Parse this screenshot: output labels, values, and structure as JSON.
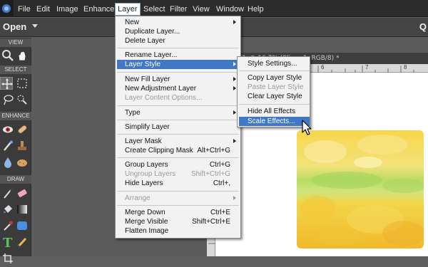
{
  "menubar": {
    "items": [
      {
        "label": "File"
      },
      {
        "label": "Edit"
      },
      {
        "label": "Image"
      },
      {
        "label": "Enhance"
      },
      {
        "label": "Layer"
      },
      {
        "label": "Select"
      },
      {
        "label": "Filter"
      },
      {
        "label": "View"
      },
      {
        "label": "Window"
      },
      {
        "label": "Help"
      }
    ],
    "active": "Layer"
  },
  "modebar": {
    "open_label": "Open",
    "right_label": "Q"
  },
  "toolbox": {
    "sections": [
      "VIEW",
      "SELECT",
      "ENHANCE",
      "DRAW"
    ]
  },
  "document": {
    "tab_title": "7, @ 16.7% (Slices 1, RGB/8) *",
    "ruler_ticks": [
      "5",
      "6",
      "7",
      "8"
    ]
  },
  "layer_menu": {
    "items": [
      {
        "label": "New",
        "submenu": true
      },
      {
        "label": "Duplicate Layer..."
      },
      {
        "label": "Delete Layer"
      },
      {
        "label": "Rename Layer..."
      },
      {
        "label": "Layer Style",
        "submenu": true,
        "highlighted": true
      },
      {
        "label": "New Fill Layer",
        "submenu": true
      },
      {
        "label": "New Adjustment Layer",
        "submenu": true
      },
      {
        "label": "Layer Content Options...",
        "disabled": true
      },
      {
        "label": "Type",
        "submenu": true
      },
      {
        "label": "Simplify Layer"
      },
      {
        "label": "Layer Mask",
        "submenu": true
      },
      {
        "label": "Create Clipping Mask",
        "shortcut": "Alt+Ctrl+G"
      },
      {
        "label": "Group Layers",
        "shortcut": "Ctrl+G"
      },
      {
        "label": "Ungroup Layers",
        "shortcut": "Shift+Ctrl+G",
        "disabled": true
      },
      {
        "label": "Hide Layers",
        "shortcut": "Ctrl+,"
      },
      {
        "label": "Arrange",
        "submenu": true,
        "disabled": true
      },
      {
        "label": "Merge Down",
        "shortcut": "Ctrl+E"
      },
      {
        "label": "Merge Visible",
        "shortcut": "Shift+Ctrl+E"
      },
      {
        "label": "Flatten Image"
      }
    ]
  },
  "layer_style_menu": {
    "items": [
      {
        "label": "Style Settings..."
      },
      {
        "label": "Copy Layer Style"
      },
      {
        "label": "Paste Layer Style",
        "disabled": true
      },
      {
        "label": "Clear Layer Style"
      },
      {
        "label": "Hide All Effects"
      },
      {
        "label": "Scale Effects...",
        "highlighted": true
      }
    ]
  },
  "colors": {
    "highlight": "#3f78c7",
    "menubar_bg": "#2c2c2c",
    "toolbox_bg": "#3b3b3b"
  }
}
